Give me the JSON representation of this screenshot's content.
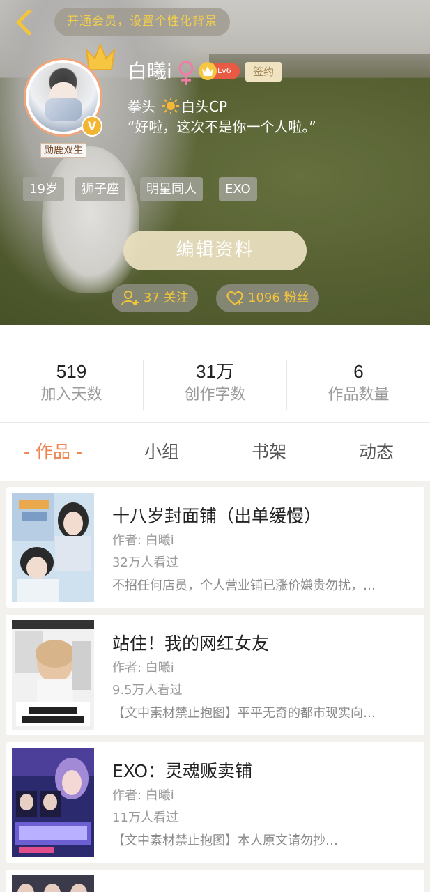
{
  "header": {
    "vip_banner": "开通会员，设置个性化背景",
    "back_icon": "back-arrow-icon"
  },
  "profile": {
    "name": "白曦i",
    "gender_icon": "female-icon",
    "level": "Lv6",
    "sign_badge": "签约",
    "avatar_caption": "勋鹿双生",
    "verified_badge": "V",
    "bio_line1_part1": "拳头",
    "bio_line1_part2": "白头CP",
    "bio_line2": "“好啦，这次不是你一个人啦。”",
    "tags": [
      "19岁",
      "狮子座",
      "明星同人",
      "EXO"
    ],
    "edit_button": "编辑资料",
    "following": "37 关注",
    "followers": "1096 粉丝"
  },
  "stats": [
    {
      "value": "519",
      "label": "加入天数"
    },
    {
      "value": "31万",
      "label": "创作字数"
    },
    {
      "value": "6",
      "label": "作品数量"
    }
  ],
  "tabs": [
    "- 作品 -",
    "小组",
    "书架",
    "动态"
  ],
  "works": [
    {
      "title": "十八岁封面铺（出单缓慢）",
      "author": "作者: 白曦i",
      "views": "32万人看过",
      "desc": "不招任何店员，个人营业铺已涨价嫌贵勿扰，…"
    },
    {
      "title": "站住！我的网红女友",
      "author": "作者: 白曦i",
      "views": "9.5万人看过",
      "desc": "【文中素材禁止抱图】平平无奇的都市现实向…"
    },
    {
      "title": "EXO：灵魂贩卖铺",
      "author": "作者: 白曦i",
      "views": "11万人看过",
      "desc": "【文中素材禁止抱图】本人原文请勿抄…"
    }
  ],
  "colors": {
    "accent": "#ef8450",
    "gold": "#f2c53a",
    "level_red": "#e85a44"
  }
}
